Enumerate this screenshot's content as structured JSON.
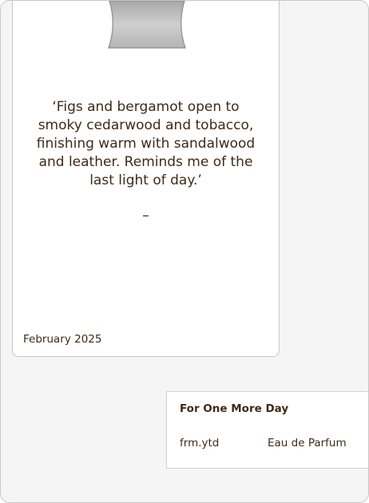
{
  "card": {
    "quote": "‘Figs and bergamot open to smoky cedarwood and tobacco, finishing warm with sandalwood and leather. Reminds me of  the last light of day.’",
    "attribution": "–",
    "date": "February 2025"
  },
  "label": {
    "title": "For One More Day",
    "brand": "frm.ytd",
    "type": "Eau de Parfum"
  },
  "colors": {
    "text": "#3f2a16",
    "background": "#f5f5f5",
    "card": "#ffffff",
    "clip": "#c4c4c4"
  },
  "icons": {
    "clip": "binder-clip-icon"
  }
}
